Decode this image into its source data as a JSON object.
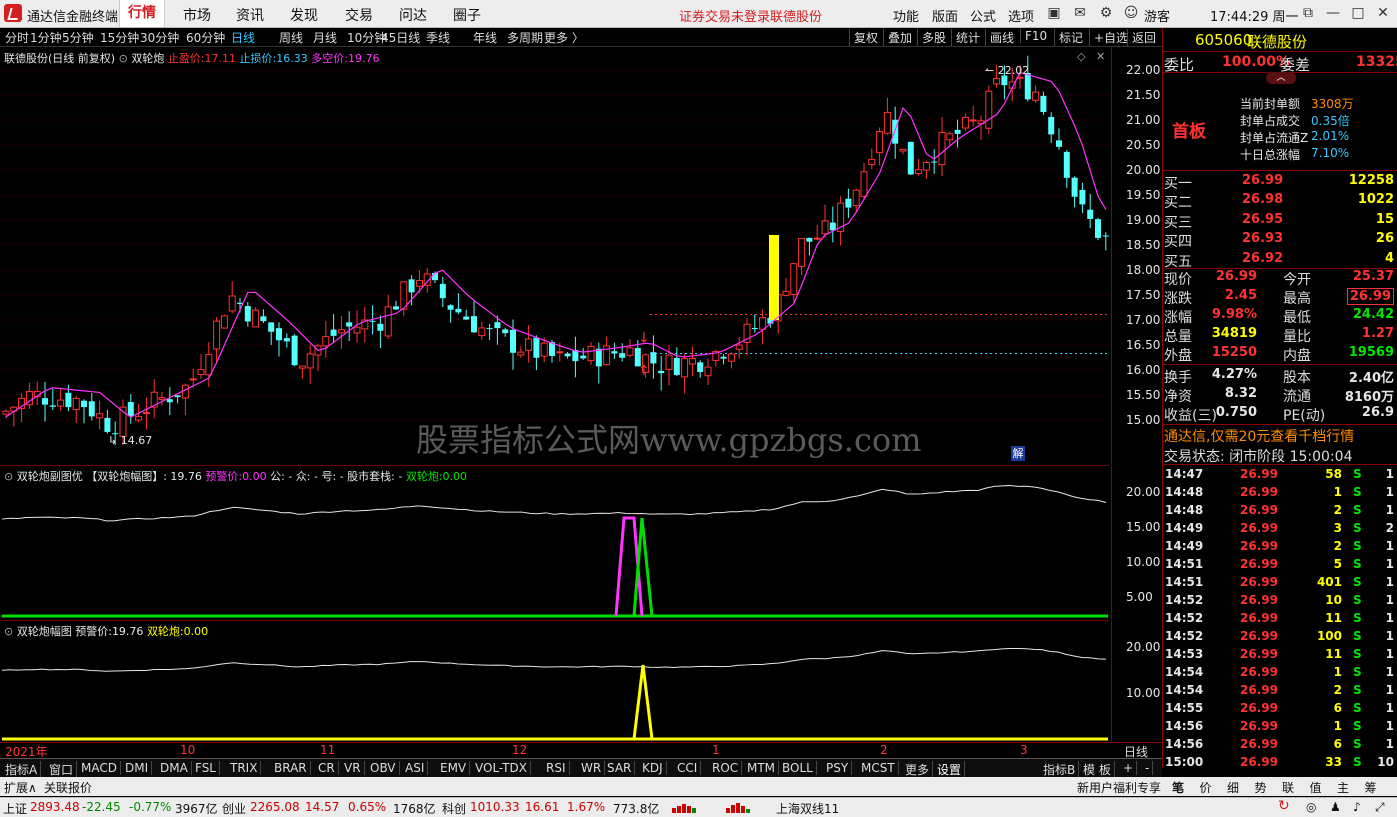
{
  "app": {
    "title": "通达信金融终端",
    "nav": [
      "行情",
      "市场",
      "资讯",
      "发现",
      "交易",
      "问达",
      "圈子"
    ],
    "nav_active": "行情",
    "notice": "证券交易未登录",
    "stock_link": "联德股份",
    "menus": [
      "功能",
      "版面",
      "公式",
      "选项"
    ],
    "user": "游客",
    "clock": "17:44:29 周一"
  },
  "toolbar": {
    "periods": [
      "分时",
      "1分钟",
      "5分钟",
      "15分钟",
      "30分钟",
      "60分钟",
      "日线",
      "周线",
      "月线",
      "10分钟",
      "45日线",
      "季线",
      "年线",
      "多周期",
      "更多 〉"
    ],
    "selected": "日线",
    "right": [
      "复权",
      "叠加",
      "多股",
      "统计",
      "画线",
      "F10",
      "标记",
      "+自选",
      "返回"
    ]
  },
  "main_chart": {
    "stock_label": "联德股份(日线 前复权)",
    "formula": "双轮炮",
    "stop_profit_label": "止盈价:",
    "stop_profit": "17.11",
    "stop_loss_label": "止损价:",
    "stop_loss": "16.33",
    "bull_bear_label": "多空价:",
    "bull_bear": "19.76",
    "high_mark": "22.02",
    "low_mark": "14.67",
    "yticks": [
      "22.00",
      "21.50",
      "21.00",
      "20.50",
      "20.00",
      "19.50",
      "19.00",
      "18.50",
      "18.00",
      "17.50",
      "17.00",
      "16.50",
      "16.00",
      "15.50",
      "15.00"
    ],
    "watermark": "股票指标公式网www.gpzbgs.com",
    "jie_label": "解"
  },
  "sub1": {
    "title": "双轮炮副图优",
    "formula_name": "【双轮炮幅图】",
    "value": ": 19.76",
    "warn_label": "预警价:",
    "warn_value": "0.00",
    "extra": "公: - 众: - 号: - 股市套栈: -",
    "gun_label": "双轮炮:",
    "gun_value": "0.00",
    "yticks": [
      "20.00",
      "15.00",
      "10.00",
      "5.00"
    ]
  },
  "sub2": {
    "title": "双轮炮幅图",
    "warn_label": "预警价:",
    "warn_value": "19.76",
    "gun_label": "双轮炮:",
    "gun_value": "0.00",
    "yticks": [
      "20.00",
      "10.00"
    ]
  },
  "xaxis": {
    "labels": [
      "2021年",
      "10",
      "11",
      "12",
      "1",
      "2",
      "3"
    ],
    "period": "日线"
  },
  "indicators": [
    "指标A",
    "窗口",
    "MACD",
    "DMI",
    "DMA",
    "FSL",
    "TRIX",
    "BRAR",
    "CR",
    "VR",
    "OBV",
    "ASI",
    "EMV",
    "VOL-TDX",
    "RSI",
    "WR",
    "SAR",
    "KDJ",
    "CCI",
    "ROC",
    "MTM",
    "BOLL",
    "PSY",
    "MCST",
    "更多",
    "设置"
  ],
  "indicator_right": [
    "指标B",
    "模 板",
    "+",
    "-"
  ],
  "panel": {
    "code": "605060",
    "name": "联德股份",
    "weibi_label": "委比",
    "weibi": "100.00%",
    "weicha_label": "委差",
    "weicha": "13325",
    "board": "首板",
    "seal_stats": [
      {
        "label": "当前封单额",
        "value": "3308万"
      },
      {
        "label": "封单占成交",
        "value": "0.35倍"
      },
      {
        "label": "封单占流通Z",
        "value": "2.01%"
      },
      {
        "label": "十日总涨幅",
        "value": "7.10%"
      }
    ],
    "bids": [
      {
        "label": "买一",
        "price": "26.99",
        "vol": "12258"
      },
      {
        "label": "买二",
        "price": "26.98",
        "vol": "1022"
      },
      {
        "label": "买三",
        "price": "26.95",
        "vol": "15"
      },
      {
        "label": "买四",
        "price": "26.93",
        "vol": "26"
      },
      {
        "label": "买五",
        "price": "26.92",
        "vol": "4"
      }
    ],
    "quote": [
      {
        "l1": "现价",
        "v1": "26.99",
        "l2": "今开",
        "v2": "25.37"
      },
      {
        "l1": "涨跌",
        "v1": "2.45",
        "l2": "最高",
        "v2": "26.99"
      },
      {
        "l1": "涨幅",
        "v1": "9.98%",
        "l2": "最低",
        "v2": "24.42"
      },
      {
        "l1": "总量",
        "v1": "34819",
        "l2": "量比",
        "v2": "1.27"
      },
      {
        "l1": "外盘",
        "v1": "15250",
        "l2": "内盘",
        "v2": "19569"
      },
      {
        "l1": "换手",
        "v1": "4.27%",
        "l2": "股本",
        "v2": "2.40亿"
      },
      {
        "l1": "净资",
        "v1": "8.32",
        "l2": "流通",
        "v2": "8160万"
      },
      {
        "l1": "收益(三)",
        "v1": "0.750",
        "l2": "PE(动)",
        "v2": "26.9"
      }
    ],
    "promo": "通达信,仅需20元查看千档行情",
    "trade_state": "交易状态: 闭市阶段 15:00:04",
    "ticks": [
      {
        "t": "14:47",
        "p": "26.99",
        "v": "58",
        "s": "S",
        "n": "1"
      },
      {
        "t": "14:48",
        "p": "26.99",
        "v": "1",
        "s": "S",
        "n": "1"
      },
      {
        "t": "14:48",
        "p": "26.99",
        "v": "2",
        "s": "S",
        "n": "1"
      },
      {
        "t": "14:49",
        "p": "26.99",
        "v": "3",
        "s": "S",
        "n": "2"
      },
      {
        "t": "14:49",
        "p": "26.99",
        "v": "2",
        "s": "S",
        "n": "1"
      },
      {
        "t": "14:51",
        "p": "26.99",
        "v": "5",
        "s": "S",
        "n": "1"
      },
      {
        "t": "14:51",
        "p": "26.99",
        "v": "401",
        "s": "S",
        "n": "1"
      },
      {
        "t": "14:52",
        "p": "26.99",
        "v": "10",
        "s": "S",
        "n": "1"
      },
      {
        "t": "14:52",
        "p": "26.99",
        "v": "11",
        "s": "S",
        "n": "1"
      },
      {
        "t": "14:52",
        "p": "26.99",
        "v": "100",
        "s": "S",
        "n": "1"
      },
      {
        "t": "14:53",
        "p": "26.99",
        "v": "11",
        "s": "S",
        "n": "1"
      },
      {
        "t": "14:54",
        "p": "26.99",
        "v": "1",
        "s": "S",
        "n": "1"
      },
      {
        "t": "14:54",
        "p": "26.99",
        "v": "2",
        "s": "S",
        "n": "1"
      },
      {
        "t": "14:55",
        "p": "26.99",
        "v": "6",
        "s": "S",
        "n": "1"
      },
      {
        "t": "14:56",
        "p": "26.99",
        "v": "1",
        "s": "S",
        "n": "1"
      },
      {
        "t": "14:56",
        "p": "26.99",
        "v": "6",
        "s": "S",
        "n": "1"
      },
      {
        "t": "15:00",
        "p": "26.99",
        "v": "33",
        "s": "S",
        "n": "10"
      }
    ],
    "tabs": [
      "笔",
      "价",
      "细",
      "势",
      "联",
      "值",
      "主",
      "筹"
    ]
  },
  "bottom": {
    "expand": "扩展∧",
    "related": "关联报价",
    "new_user": "新用户福利专享",
    "sh_label": "上证",
    "sh_val": "2893.48",
    "sh_chg": "-22.45",
    "sh_pct": "-0.77%",
    "sh_amt": "3967亿",
    "cy_label": "创业",
    "cy_val": "2265.08",
    "cy_chg": "14.57",
    "cy_pct": "0.65%",
    "cy_amt": "1768亿",
    "kc_label": "科创",
    "kc_val": "1010.33",
    "kc_chg": "16.61",
    "kc_pct": "1.67%",
    "kc_amt": "773.8亿",
    "ticker": "上海双线11"
  },
  "colors": {
    "up": "#ff3232",
    "down": "#54ffff",
    "ma": "#ff33ff",
    "accent": "#ffff00"
  }
}
